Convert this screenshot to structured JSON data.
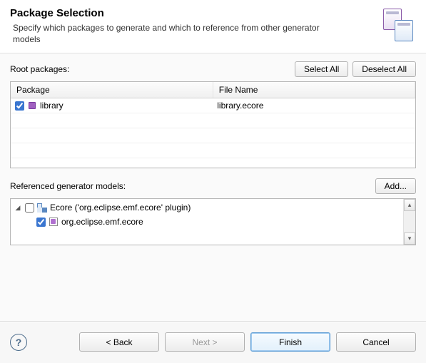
{
  "header": {
    "title": "Package Selection",
    "description": "Specify which packages to generate and which to reference from other generator models"
  },
  "root_packages": {
    "label": "Root packages:",
    "select_all": "Select All",
    "deselect_all": "Deselect All",
    "columns": {
      "package": "Package",
      "filename": "File Name"
    },
    "rows": [
      {
        "checked": true,
        "name": "library",
        "filename": "library.ecore"
      }
    ]
  },
  "referenced": {
    "label": "Referenced generator models:",
    "add": "Add...",
    "tree": {
      "root": {
        "checked": false,
        "label": "Ecore ('org.eclipse.emf.ecore' plugin)"
      },
      "child": {
        "checked": true,
        "label": "org.eclipse.emf.ecore"
      }
    }
  },
  "wizard": {
    "back": "< Back",
    "next": "Next >",
    "finish": "Finish",
    "cancel": "Cancel"
  }
}
